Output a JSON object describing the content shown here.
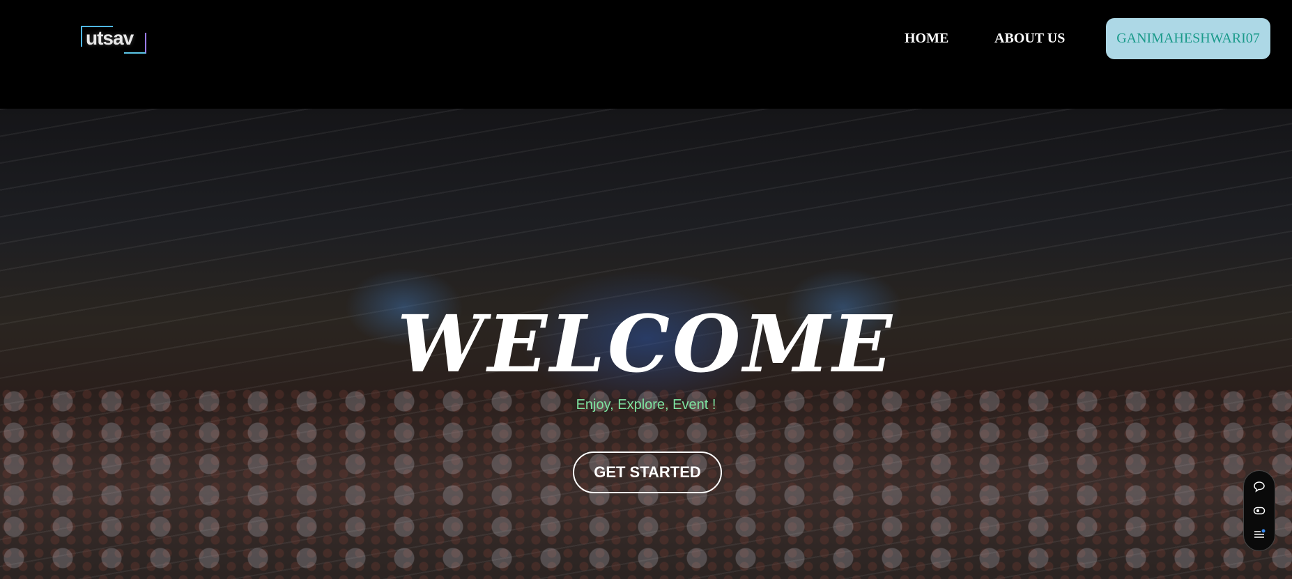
{
  "nav": {
    "logo_text": "utsav",
    "links": [
      {
        "label": "HOME"
      },
      {
        "label": "ABOUT US"
      }
    ],
    "user_button": "GANIMAHESHWARI07"
  },
  "hero": {
    "title": "WELCOME",
    "subtitle": "Enjoy, Explore, Event !",
    "cta": "GET STARTED"
  },
  "widget": {
    "icons": [
      "chat-icon",
      "eye-icon",
      "menu-icon"
    ],
    "accent": "#3b8cf0"
  }
}
